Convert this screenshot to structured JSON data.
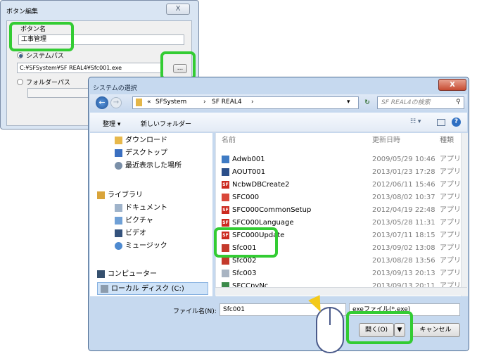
{
  "button_dialog": {
    "title": "ボタン編集",
    "close_label": "X",
    "button_name_label": "ボタン名",
    "button_name_value": "工事管理",
    "system_path_label": "システムパス",
    "system_path_value": "C:¥SFSystem¥SF REAL4¥Sfc001.exe",
    "browse_label": "...",
    "folder_path_label": "フォルダーパス"
  },
  "select_dialog": {
    "title": "システムの選択",
    "close_label": "X",
    "breadcrumb": [
      "«",
      "SFSystem",
      "›",
      "SF REAL4",
      "›"
    ],
    "search_placeholder": "SF REAL4の検索",
    "toolbar": {
      "organize": "整理 ▾",
      "new_folder": "新しいフォルダー"
    },
    "nav_items": [
      {
        "label": "ダウンロード",
        "icon": "download-folder-icon"
      },
      {
        "label": "デスクトップ",
        "icon": "desktop-icon"
      },
      {
        "label": "最近表示した場所",
        "icon": "recent-places-icon"
      },
      {
        "label": "ライブラリ",
        "icon": "library-icon"
      },
      {
        "label": "ドキュメント",
        "icon": "documents-icon"
      },
      {
        "label": "ピクチャ",
        "icon": "pictures-icon"
      },
      {
        "label": "ビデオ",
        "icon": "video-icon"
      },
      {
        "label": "ミュージック",
        "icon": "music-icon"
      },
      {
        "label": "コンピューター",
        "icon": "computer-icon"
      },
      {
        "label": "ローカル ディスク (C:)",
        "icon": "local-disk-icon"
      }
    ],
    "columns": {
      "name": "名前",
      "modified": "更新日時",
      "type": "種類"
    },
    "files": [
      {
        "name": "Adwb001",
        "date": "2009/05/29 10:46",
        "type": "アプリ"
      },
      {
        "name": "AOUT001",
        "date": "2013/01/23 17:28",
        "type": "アプリ"
      },
      {
        "name": "NcbwDBCreate2",
        "date": "2012/06/11 15:46",
        "type": "アプリ"
      },
      {
        "name": "SFC000",
        "date": "2013/08/02 10:37",
        "type": "アプリ"
      },
      {
        "name": "SFC000CommonSetup",
        "date": "2012/04/19 22:48",
        "type": "アプリ"
      },
      {
        "name": "SFC000Language",
        "date": "2013/05/28 11:31",
        "type": "アプリ"
      },
      {
        "name": "SFC000Update",
        "date": "2013/07/11 18:15",
        "type": "アプリ"
      },
      {
        "name": "Sfc001",
        "date": "2013/09/02 13:08",
        "type": "アプリ"
      },
      {
        "name": "Sfc002",
        "date": "2013/08/28 13:56",
        "type": "アプリ"
      },
      {
        "name": "Sfc003",
        "date": "2013/09/13 20:13",
        "type": "アプリ"
      },
      {
        "name": "SFCCnvNc",
        "date": "2013/09/13 20:11",
        "type": "アプリ"
      }
    ],
    "filename_label": "ファイル名(N):",
    "filename_value": "Sfc001",
    "filetype_value": "exeファイル(*.exe)",
    "open_label": "開く(O)",
    "cancel_label": "キャンセル"
  }
}
